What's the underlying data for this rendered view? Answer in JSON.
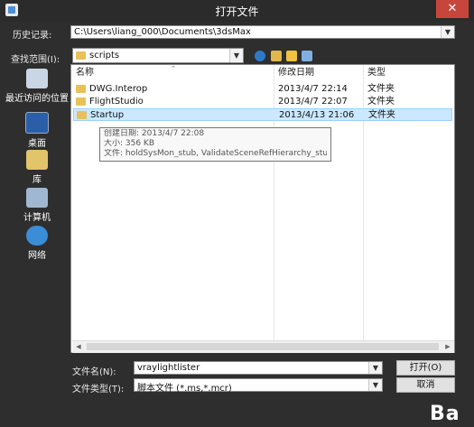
{
  "window": {
    "title": "打开文件",
    "close": "✕"
  },
  "history": {
    "label": "历史记录:",
    "value": "C:\\Users\\liang_000\\Documents\\3dsMax"
  },
  "lookin": {
    "label": "查找范围(I):",
    "value": "scripts"
  },
  "places": [
    {
      "label": "最近访问的位置",
      "icon": "recent-icon"
    },
    {
      "label": "桌面",
      "icon": "desktop-icon"
    },
    {
      "label": "库",
      "icon": "library-icon"
    },
    {
      "label": "计算机",
      "icon": "computer-icon"
    },
    {
      "label": "网络",
      "icon": "network-icon"
    }
  ],
  "columns": {
    "name": "名称",
    "date": "修改日期",
    "type": "类型"
  },
  "files": [
    {
      "name": "DWG.Interop",
      "date": "2013/4/7 22:14",
      "type": "文件夹"
    },
    {
      "name": "FlightStudio",
      "date": "2013/4/7 22:07",
      "type": "文件夹"
    },
    {
      "name": "Startup",
      "date": "2013/4/13 21:06",
      "type": "文件夹"
    }
  ],
  "tooltip": {
    "created": "创建日期: 2013/4/7 22:08",
    "size": "大小: 356 KB",
    "files": "文件: holdSysMon_stub, ValidateSceneRefHierarchy_stub, ..."
  },
  "filename": {
    "label": "文件名(N):",
    "value": "vraylightlister"
  },
  "filetype": {
    "label": "文件类型(T):",
    "value": "脚本文件 (*.ms,*.mcr)"
  },
  "buttons": {
    "open": "打开(O)",
    "cancel": "取消"
  },
  "watermark": "Ba"
}
